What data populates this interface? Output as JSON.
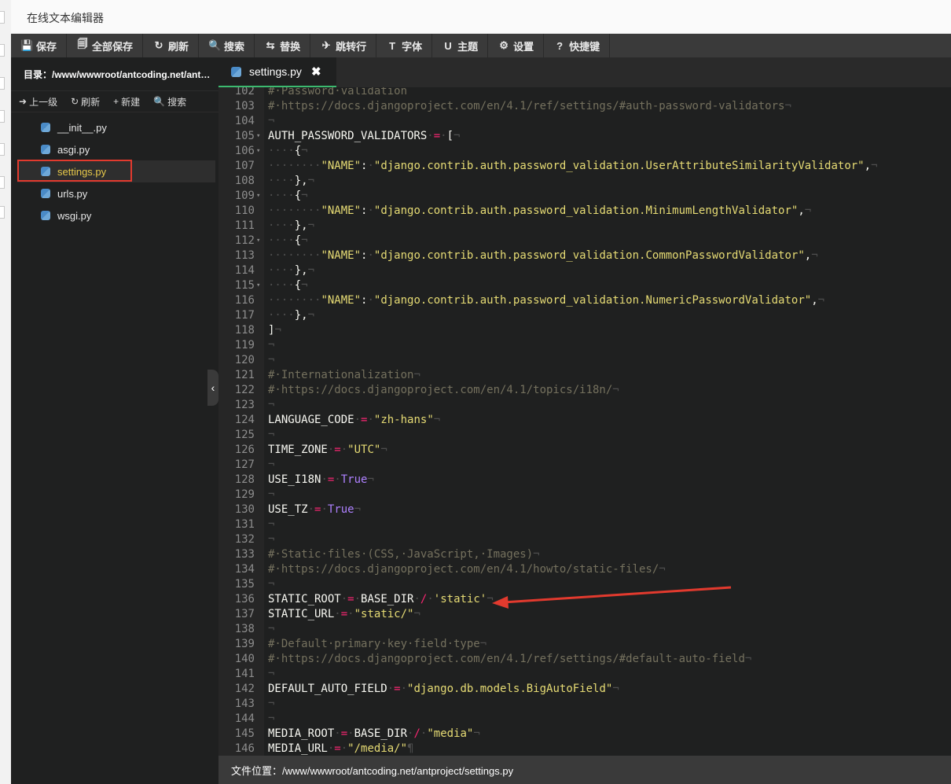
{
  "app": {
    "title": "在线文本编辑器"
  },
  "toolbar": {
    "buttons": [
      {
        "label": "保存",
        "icon": "save-icon",
        "glyph": "💾"
      },
      {
        "label": "全部保存",
        "icon": "save-all-icon",
        "glyph": "🗐"
      },
      {
        "label": "刷新",
        "icon": "refresh-icon",
        "glyph": "↻"
      },
      {
        "label": "搜索",
        "icon": "search-icon",
        "glyph": "🔍"
      },
      {
        "label": "替换",
        "icon": "replace-icon",
        "glyph": "⇆"
      },
      {
        "label": "跳转行",
        "icon": "goto-line-icon",
        "glyph": "✈"
      },
      {
        "label": "字体",
        "icon": "font-icon",
        "glyph": "T"
      },
      {
        "label": "主题",
        "icon": "theme-icon",
        "glyph": "U"
      },
      {
        "label": "设置",
        "icon": "gear-icon",
        "glyph": "⚙"
      },
      {
        "label": "快捷键",
        "icon": "help-icon",
        "glyph": "?"
      }
    ]
  },
  "sidebar": {
    "dir_label": "目录：/www/wwwroot/antcoding.net/antpr...",
    "actions": [
      {
        "label": "上一级",
        "icon": "arrow-up-icon",
        "glyph": "➜"
      },
      {
        "label": "刷新",
        "icon": "refresh-icon",
        "glyph": "↻"
      },
      {
        "label": "新建",
        "icon": "plus-icon",
        "glyph": "+"
      },
      {
        "label": "搜索",
        "icon": "search-icon",
        "glyph": "🔍"
      }
    ],
    "files": [
      {
        "name": "__init__.py",
        "active": false
      },
      {
        "name": "asgi.py",
        "active": false
      },
      {
        "name": "settings.py",
        "active": true
      },
      {
        "name": "urls.py",
        "active": false
      },
      {
        "name": "wsgi.py",
        "active": false
      }
    ]
  },
  "tab": {
    "label": "settings.py",
    "close_glyph": "✖"
  },
  "collapse_glyph": "‹",
  "statusbar": {
    "file_location": "文件位置：/www/wwwroot/antcoding.net/antproject/settings.py"
  },
  "colors": {
    "accent": "#3cba6f",
    "highlight_box": "#e23a2e",
    "active_file": "#e6c84a"
  },
  "editor": {
    "lines": [
      {
        "n": "102",
        "f": false,
        "t": [
          [
            "comment",
            "#·Password·validation"
          ]
        ]
      },
      {
        "n": "103",
        "f": false,
        "t": [
          [
            "comment",
            "#·https://docs.djangoproject.com/en/4.1/ref/settings/#auth-password-validators"
          ],
          [
            "ws",
            "¬"
          ]
        ]
      },
      {
        "n": "104",
        "f": false,
        "t": [
          [
            "ws",
            "¬"
          ]
        ]
      },
      {
        "n": "105",
        "f": true,
        "t": [
          [
            "plain",
            "AUTH_PASSWORD_VALIDATORS"
          ],
          [
            "ws",
            "·"
          ],
          [
            "op",
            "="
          ],
          [
            "ws",
            "·"
          ],
          [
            "plain",
            "["
          ],
          [
            "ws",
            "¬"
          ]
        ]
      },
      {
        "n": "106",
        "f": true,
        "t": [
          [
            "ws",
            "····"
          ],
          [
            "plain",
            "{"
          ],
          [
            "ws",
            "¬"
          ]
        ]
      },
      {
        "n": "107",
        "f": false,
        "t": [
          [
            "ws",
            "········"
          ],
          [
            "string",
            "\"NAME\""
          ],
          [
            "plain",
            ":"
          ],
          [
            "ws",
            "·"
          ],
          [
            "string",
            "\"django.contrib.auth.password_validation.UserAttributeSimilarityValidator\""
          ],
          [
            "plain",
            ","
          ],
          [
            "ws",
            "¬"
          ]
        ]
      },
      {
        "n": "108",
        "f": false,
        "t": [
          [
            "ws",
            "····"
          ],
          [
            "plain",
            "},"
          ],
          [
            "ws",
            "¬"
          ]
        ]
      },
      {
        "n": "109",
        "f": true,
        "t": [
          [
            "ws",
            "····"
          ],
          [
            "plain",
            "{"
          ],
          [
            "ws",
            "¬"
          ]
        ]
      },
      {
        "n": "110",
        "f": false,
        "t": [
          [
            "ws",
            "········"
          ],
          [
            "string",
            "\"NAME\""
          ],
          [
            "plain",
            ":"
          ],
          [
            "ws",
            "·"
          ],
          [
            "string",
            "\"django.contrib.auth.password_validation.MinimumLengthValidator\""
          ],
          [
            "plain",
            ","
          ],
          [
            "ws",
            "¬"
          ]
        ]
      },
      {
        "n": "111",
        "f": false,
        "t": [
          [
            "ws",
            "····"
          ],
          [
            "plain",
            "},"
          ],
          [
            "ws",
            "¬"
          ]
        ]
      },
      {
        "n": "112",
        "f": true,
        "t": [
          [
            "ws",
            "····"
          ],
          [
            "plain",
            "{"
          ],
          [
            "ws",
            "¬"
          ]
        ]
      },
      {
        "n": "113",
        "f": false,
        "t": [
          [
            "ws",
            "········"
          ],
          [
            "string",
            "\"NAME\""
          ],
          [
            "plain",
            ":"
          ],
          [
            "ws",
            "·"
          ],
          [
            "string",
            "\"django.contrib.auth.password_validation.CommonPasswordValidator\""
          ],
          [
            "plain",
            ","
          ],
          [
            "ws",
            "¬"
          ]
        ]
      },
      {
        "n": "114",
        "f": false,
        "t": [
          [
            "ws",
            "····"
          ],
          [
            "plain",
            "},"
          ],
          [
            "ws",
            "¬"
          ]
        ]
      },
      {
        "n": "115",
        "f": true,
        "t": [
          [
            "ws",
            "····"
          ],
          [
            "plain",
            "{"
          ],
          [
            "ws",
            "¬"
          ]
        ]
      },
      {
        "n": "116",
        "f": false,
        "t": [
          [
            "ws",
            "········"
          ],
          [
            "string",
            "\"NAME\""
          ],
          [
            "plain",
            ":"
          ],
          [
            "ws",
            "·"
          ],
          [
            "string",
            "\"django.contrib.auth.password_validation.NumericPasswordValidator\""
          ],
          [
            "plain",
            ","
          ],
          [
            "ws",
            "¬"
          ]
        ]
      },
      {
        "n": "117",
        "f": false,
        "t": [
          [
            "ws",
            "····"
          ],
          [
            "plain",
            "},"
          ],
          [
            "ws",
            "¬"
          ]
        ]
      },
      {
        "n": "118",
        "f": false,
        "t": [
          [
            "plain",
            "]"
          ],
          [
            "ws",
            "¬"
          ]
        ]
      },
      {
        "n": "119",
        "f": false,
        "t": [
          [
            "ws",
            "¬"
          ]
        ]
      },
      {
        "n": "120",
        "f": false,
        "t": [
          [
            "ws",
            "¬"
          ]
        ]
      },
      {
        "n": "121",
        "f": false,
        "t": [
          [
            "comment",
            "#·Internationalization"
          ],
          [
            "ws",
            "¬"
          ]
        ]
      },
      {
        "n": "122",
        "f": false,
        "t": [
          [
            "comment",
            "#·https://docs.djangoproject.com/en/4.1/topics/i18n/"
          ],
          [
            "ws",
            "¬"
          ]
        ]
      },
      {
        "n": "123",
        "f": false,
        "t": [
          [
            "ws",
            "¬"
          ]
        ]
      },
      {
        "n": "124",
        "f": false,
        "t": [
          [
            "plain",
            "LANGUAGE_CODE"
          ],
          [
            "ws",
            "·"
          ],
          [
            "op",
            "="
          ],
          [
            "ws",
            "·"
          ],
          [
            "string",
            "\"zh-hans\""
          ],
          [
            "ws",
            "¬"
          ]
        ]
      },
      {
        "n": "125",
        "f": false,
        "t": [
          [
            "ws",
            "¬"
          ]
        ]
      },
      {
        "n": "126",
        "f": false,
        "t": [
          [
            "plain",
            "TIME_ZONE"
          ],
          [
            "ws",
            "·"
          ],
          [
            "op",
            "="
          ],
          [
            "ws",
            "·"
          ],
          [
            "string",
            "\"UTC\""
          ],
          [
            "ws",
            "¬"
          ]
        ]
      },
      {
        "n": "127",
        "f": false,
        "t": [
          [
            "ws",
            "¬"
          ]
        ]
      },
      {
        "n": "128",
        "f": false,
        "t": [
          [
            "plain",
            "USE_I18N"
          ],
          [
            "ws",
            "·"
          ],
          [
            "op",
            "="
          ],
          [
            "ws",
            "·"
          ],
          [
            "const",
            "True"
          ],
          [
            "ws",
            "¬"
          ]
        ]
      },
      {
        "n": "129",
        "f": false,
        "t": [
          [
            "ws",
            "¬"
          ]
        ]
      },
      {
        "n": "130",
        "f": false,
        "t": [
          [
            "plain",
            "USE_TZ"
          ],
          [
            "ws",
            "·"
          ],
          [
            "op",
            "="
          ],
          [
            "ws",
            "·"
          ],
          [
            "const",
            "True"
          ],
          [
            "ws",
            "¬"
          ]
        ]
      },
      {
        "n": "131",
        "f": false,
        "t": [
          [
            "ws",
            "¬"
          ]
        ]
      },
      {
        "n": "132",
        "f": false,
        "t": [
          [
            "ws",
            "¬"
          ]
        ]
      },
      {
        "n": "133",
        "f": false,
        "t": [
          [
            "comment",
            "#·Static·files·(CSS,·JavaScript,·Images)"
          ],
          [
            "ws",
            "¬"
          ]
        ]
      },
      {
        "n": "134",
        "f": false,
        "t": [
          [
            "comment",
            "#·https://docs.djangoproject.com/en/4.1/howto/static-files/"
          ],
          [
            "ws",
            "¬"
          ]
        ]
      },
      {
        "n": "135",
        "f": false,
        "t": [
          [
            "ws",
            "¬"
          ]
        ]
      },
      {
        "n": "136",
        "f": false,
        "t": [
          [
            "plain",
            "STATIC_ROOT"
          ],
          [
            "ws",
            "·"
          ],
          [
            "op",
            "="
          ],
          [
            "ws",
            "·"
          ],
          [
            "plain",
            "BASE_DIR"
          ],
          [
            "ws",
            "·"
          ],
          [
            "op",
            "/"
          ],
          [
            "ws",
            "·"
          ],
          [
            "string",
            "'static'"
          ],
          [
            "ws",
            "¬"
          ]
        ]
      },
      {
        "n": "137",
        "f": false,
        "t": [
          [
            "plain",
            "STATIC_URL"
          ],
          [
            "ws",
            "·"
          ],
          [
            "op",
            "="
          ],
          [
            "ws",
            "·"
          ],
          [
            "string",
            "\"static/\""
          ],
          [
            "ws",
            "¬"
          ]
        ]
      },
      {
        "n": "138",
        "f": false,
        "t": [
          [
            "ws",
            "¬"
          ]
        ]
      },
      {
        "n": "139",
        "f": false,
        "t": [
          [
            "comment",
            "#·Default·primary·key·field·type"
          ],
          [
            "ws",
            "¬"
          ]
        ]
      },
      {
        "n": "140",
        "f": false,
        "t": [
          [
            "comment",
            "#·https://docs.djangoproject.com/en/4.1/ref/settings/#default-auto-field"
          ],
          [
            "ws",
            "¬"
          ]
        ]
      },
      {
        "n": "141",
        "f": false,
        "t": [
          [
            "ws",
            "¬"
          ]
        ]
      },
      {
        "n": "142",
        "f": false,
        "t": [
          [
            "plain",
            "DEFAULT_AUTO_FIELD"
          ],
          [
            "ws",
            "·"
          ],
          [
            "op",
            "="
          ],
          [
            "ws",
            "·"
          ],
          [
            "string",
            "\"django.db.models.BigAutoField\""
          ],
          [
            "ws",
            "¬"
          ]
        ]
      },
      {
        "n": "143",
        "f": false,
        "t": [
          [
            "ws",
            "¬"
          ]
        ]
      },
      {
        "n": "144",
        "f": false,
        "t": [
          [
            "ws",
            "¬"
          ]
        ]
      },
      {
        "n": "145",
        "f": false,
        "t": [
          [
            "plain",
            "MEDIA_ROOT"
          ],
          [
            "ws",
            "·"
          ],
          [
            "op",
            "="
          ],
          [
            "ws",
            "·"
          ],
          [
            "plain",
            "BASE_DIR"
          ],
          [
            "ws",
            "·"
          ],
          [
            "op",
            "/"
          ],
          [
            "ws",
            "·"
          ],
          [
            "string",
            "\"media\""
          ],
          [
            "ws",
            "¬"
          ]
        ]
      },
      {
        "n": "146",
        "f": false,
        "t": [
          [
            "plain",
            "MEDIA_URL"
          ],
          [
            "ws",
            "·"
          ],
          [
            "op",
            "="
          ],
          [
            "ws",
            "·"
          ],
          [
            "string",
            "\"/media/\""
          ],
          [
            "ws",
            "¶"
          ]
        ]
      }
    ]
  }
}
